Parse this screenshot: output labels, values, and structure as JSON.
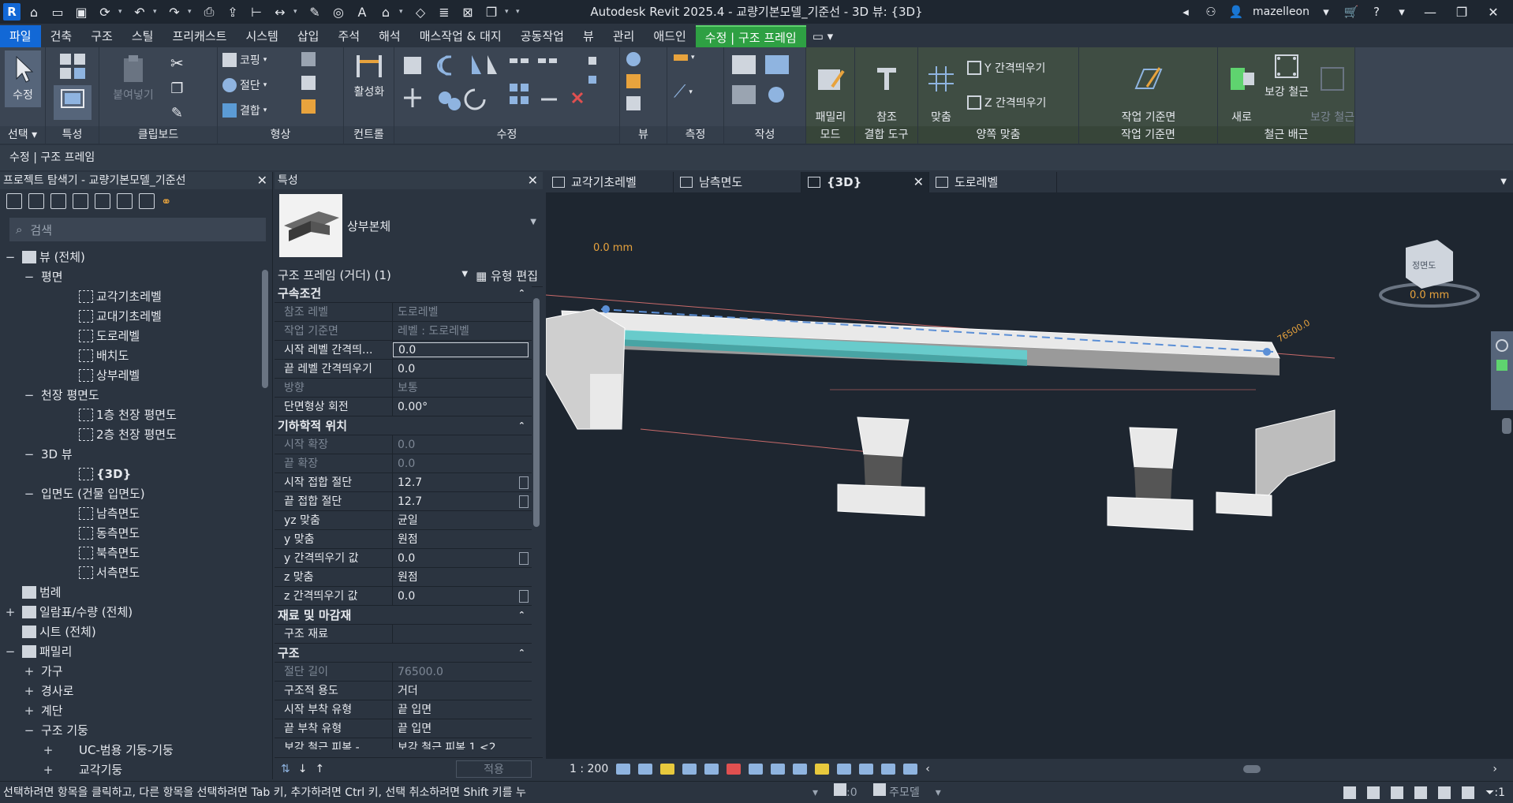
{
  "title_bar": {
    "app_title": "Autodesk Revit 2025.4 - 교량기본모델_기준선 - 3D 뷰: {3D}",
    "app_logo": "R",
    "user": "mazelleon"
  },
  "ribbon_tabs": [
    {
      "label": "파일",
      "kind": "file"
    },
    {
      "label": "건축"
    },
    {
      "label": "구조"
    },
    {
      "label": "스틸"
    },
    {
      "label": "프리캐스트"
    },
    {
      "label": "시스템"
    },
    {
      "label": "삽입"
    },
    {
      "label": "주석"
    },
    {
      "label": "해석"
    },
    {
      "label": "매스작업 & 대지"
    },
    {
      "label": "공동작업"
    },
    {
      "label": "뷰"
    },
    {
      "label": "관리"
    },
    {
      "label": "애드인"
    },
    {
      "label": "수정 | 구조 프레임",
      "kind": "ctx"
    }
  ],
  "ribbon": {
    "select": {
      "modify_label": "수정",
      "panel": "선택"
    },
    "properties": {
      "panel": "특성"
    },
    "clipboard": {
      "paste_label": "붙여넣기",
      "panel": "클립보드"
    },
    "geometry": {
      "cope": "코핑",
      "cut": "절단",
      "join": "결합",
      "panel": "형상"
    },
    "controls": {
      "activate": "활성화",
      "panel": "컨트롤"
    },
    "modify": {
      "panel": "수정"
    },
    "view": {
      "panel": "뷰"
    },
    "measure": {
      "panel": "측정"
    },
    "create": {
      "panel": "작성"
    },
    "mode": {
      "edit_family": "패밀리\n편집",
      "panel": "모드"
    },
    "join_tools": {
      "change_ref": "참조\n변경",
      "panel": "결합 도구"
    },
    "justify": {
      "justify_point": "맞춤\n점",
      "y_offset": "Y 간격띄우기",
      "z_offset": "Z 간격띄우기",
      "panel": "양쪽 맞춤"
    },
    "work_plane": {
      "edit_wp": "작업 기준면\n편집",
      "panel": "작업 기준면"
    },
    "rebar": {
      "new_select": "새로\n선택",
      "rebar_label": "보강 철근",
      "rebar_prop": "보강 철근\n전파",
      "panel": "철근 배근"
    }
  },
  "options_bar": {
    "text": "수정 | 구조 프레임"
  },
  "project_browser": {
    "title": "프로젝트 탐색기 - 교량기본모델_기준선",
    "search_placeholder": "검색",
    "items": [
      {
        "label": "뷰 (전체)",
        "level": 0,
        "toggle": "−",
        "icon": "views"
      },
      {
        "label": "평면",
        "level": 1,
        "toggle": "−"
      },
      {
        "label": "교각기초레벨",
        "level": 2,
        "icon": "view"
      },
      {
        "label": "교대기초레벨",
        "level": 2,
        "icon": "view"
      },
      {
        "label": "도로레벨",
        "level": 2,
        "icon": "view"
      },
      {
        "label": "배치도",
        "level": 2,
        "icon": "view"
      },
      {
        "label": "상부레벨",
        "level": 2,
        "icon": "view"
      },
      {
        "label": "천장 평면도",
        "level": 1,
        "toggle": "−"
      },
      {
        "label": "1층 천장 평면도",
        "level": 2,
        "icon": "view"
      },
      {
        "label": "2층 천장 평면도",
        "level": 2,
        "icon": "view"
      },
      {
        "label": "3D 뷰",
        "level": 1,
        "toggle": "−"
      },
      {
        "label": "{3D}",
        "level": 2,
        "icon": "view",
        "bold": true
      },
      {
        "label": "입면도 (건물 입면도)",
        "level": 1,
        "toggle": "−"
      },
      {
        "label": "남측면도",
        "level": 2,
        "icon": "view"
      },
      {
        "label": "동측면도",
        "level": 2,
        "icon": "view"
      },
      {
        "label": "북측면도",
        "level": 2,
        "icon": "view"
      },
      {
        "label": "서측면도",
        "level": 2,
        "icon": "view"
      },
      {
        "label": "범례",
        "level": 0,
        "icon": "file"
      },
      {
        "label": "일람표/수량 (전체)",
        "level": 0,
        "toggle": "+",
        "icon": "file"
      },
      {
        "label": "시트 (전체)",
        "level": 0,
        "icon": "file"
      },
      {
        "label": "패밀리",
        "level": 0,
        "toggle": "−",
        "icon": "file"
      },
      {
        "label": "가구",
        "level": 1,
        "toggle": "+"
      },
      {
        "label": "경사로",
        "level": 1,
        "toggle": "+"
      },
      {
        "label": "계단",
        "level": 1,
        "toggle": "+"
      },
      {
        "label": "구조 기둥",
        "level": 1,
        "toggle": "−"
      },
      {
        "label": "UC-범용 기둥-기둥",
        "level": 2,
        "toggle": "+"
      },
      {
        "label": "교각기둥",
        "level": 2,
        "toggle": "+"
      }
    ]
  },
  "properties": {
    "title": "특성",
    "type_name": "상부본체",
    "instance_selector": "구조 프레임 (거더) (1)",
    "edit_type": "유형 편집",
    "apply": "적용",
    "groups": [
      {
        "name": "구속조건",
        "rows": [
          {
            "k": "참조 레벨",
            "v": "도로레벨",
            "ro": true
          },
          {
            "k": "작업 기준면",
            "v": "레벨 : 도로레벨",
            "ro": true
          },
          {
            "k": "시작 레벨 간격띄...",
            "v": "0.0",
            "box": true
          },
          {
            "k": "끝 레벨 간격띄우기",
            "v": "0.0"
          },
          {
            "k": "방향",
            "v": "보통",
            "ro": true
          },
          {
            "k": "단면형상 회전",
            "v": "0.00°"
          }
        ]
      },
      {
        "name": "기하학적 위치",
        "rows": [
          {
            "k": "시작 확장",
            "v": "0.0",
            "ro": true
          },
          {
            "k": "끝 확장",
            "v": "0.0",
            "ro": true
          },
          {
            "k": "시작 접합 절단",
            "v": "12.7",
            "btn": true
          },
          {
            "k": "끝 접합 절단",
            "v": "12.7",
            "btn": true
          },
          {
            "k": "yz 맞춤",
            "v": "균일"
          },
          {
            "k": "y 맞춤",
            "v": "원점"
          },
          {
            "k": "y 간격띄우기 값",
            "v": "0.0",
            "btn": true
          },
          {
            "k": "z 맞춤",
            "v": "원점"
          },
          {
            "k": "z 간격띄우기 값",
            "v": "0.0",
            "btn": true
          }
        ]
      },
      {
        "name": "재료 및 마감재",
        "rows": [
          {
            "k": "구조 재료",
            "v": ""
          }
        ]
      },
      {
        "name": "구조",
        "rows": [
          {
            "k": "절단 길이",
            "v": "76500.0",
            "ro": true
          },
          {
            "k": "구조적 용도",
            "v": "거더"
          },
          {
            "k": "시작 부착 유형",
            "v": "끝 입면"
          },
          {
            "k": "끝 부착 유형",
            "v": "끝 입면"
          },
          {
            "k": "보강 철근 피복 - ...",
            "v": "보강 철근 피복 1 <2..."
          }
        ]
      }
    ]
  },
  "view_tabs": [
    {
      "label": "교각기초레벨",
      "icon": "plan"
    },
    {
      "label": "남측면도",
      "icon": "elev"
    },
    {
      "label": "{3D}",
      "icon": "home",
      "active": true
    },
    {
      "label": "도로레벨",
      "icon": "plan"
    }
  ],
  "view3d": {
    "label_left": "0.0 mm",
    "label_right": "0.0 mm",
    "viewcube_label": "정면도",
    "length_tag": "76500.0"
  },
  "view_bar": {
    "scale": "1 : 200"
  },
  "status_bar": {
    "message": "선택하려면 항목을 클릭하고, 다른 항목을 선택하려면 Tab 키, 추가하려면 Ctrl 키, 선택 취소하려면 Shift 키를 누",
    "worksets": ":0",
    "model": "주모델",
    "filter": ":1"
  }
}
